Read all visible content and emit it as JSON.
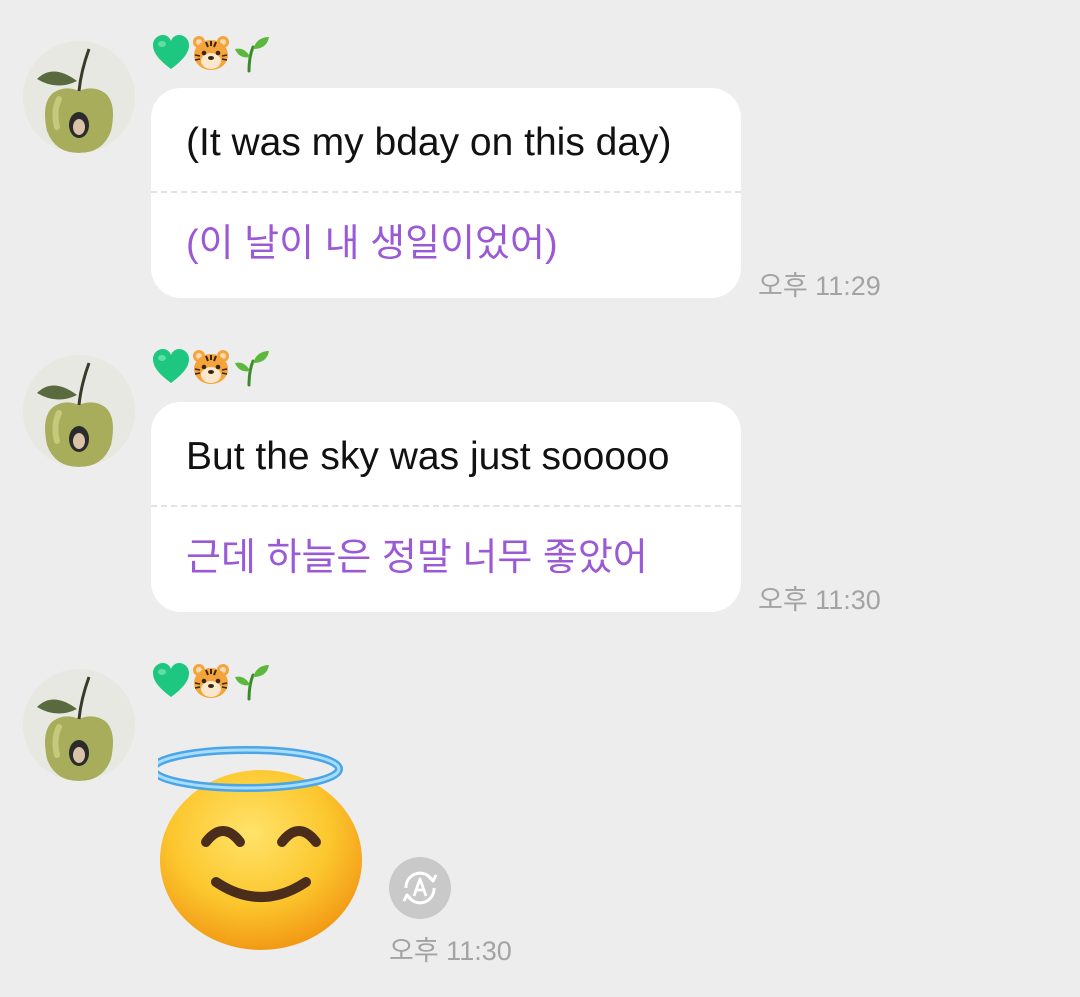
{
  "sender": {
    "badge_icons": [
      "green-heart-icon",
      "tiger-face-icon",
      "seedling-icon"
    ],
    "avatar": "apple-avatar"
  },
  "messages": [
    {
      "original": "(It was my bday on this day)",
      "translation": "(이 날이 내 생일이었어)",
      "time": "오후 11:29"
    },
    {
      "original": "But the sky was just sooooo",
      "translation": "근데 하늘은 정말 너무 좋았어",
      "time": "오후 11:30"
    },
    {
      "emoji": "smiling-face-with-halo-icon",
      "time": "오후 11:30",
      "translate_icon": "translate-icon"
    }
  ],
  "colors": {
    "background": "#ededed",
    "bubble": "#ffffff",
    "translation_text": "#9b59d6",
    "timestamp": "#a3a3a3"
  }
}
